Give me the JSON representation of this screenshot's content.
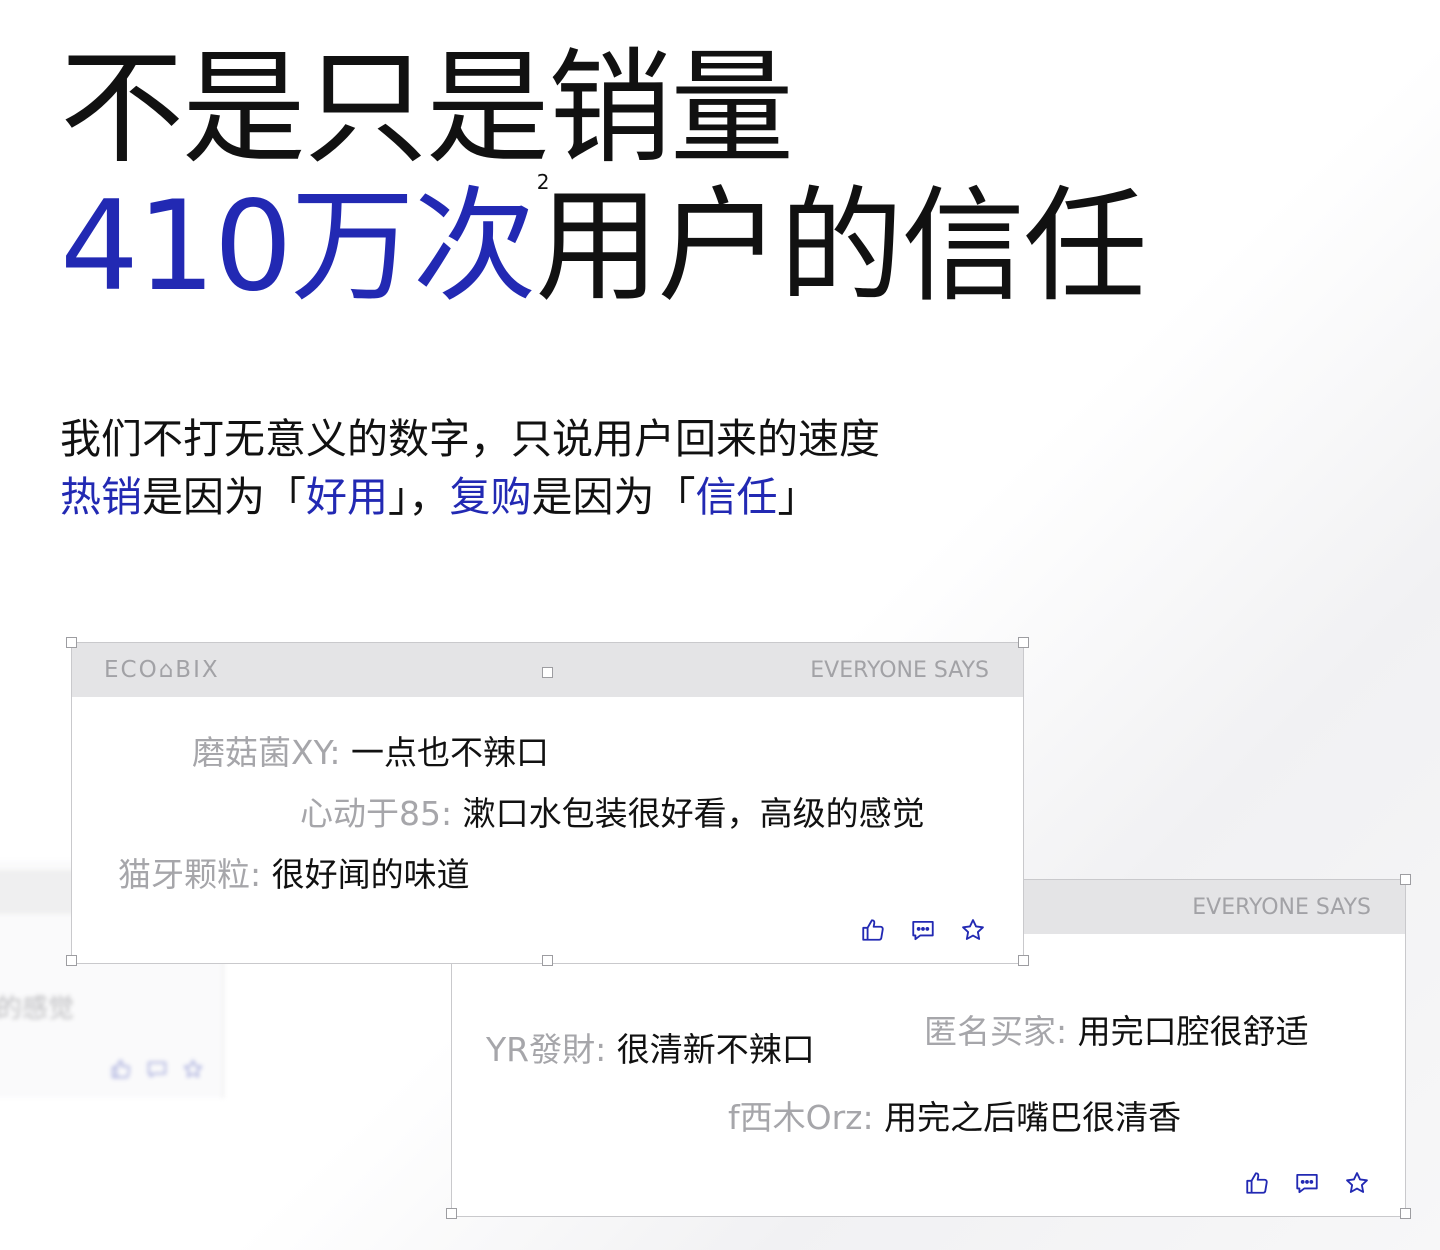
{
  "headline": {
    "line1": "不是只是销量",
    "line2_accent": "410万次",
    "line2_sup": "2",
    "line2_rest": "用户的信任"
  },
  "subtitle": {
    "line1": "我们不打无意义的数字，只说用户回来的速度",
    "line2": {
      "p1_accent": "热销",
      "p2": "是因为「",
      "p3_accent": "好用",
      "p4": "」，",
      "p5_accent": "复购",
      "p6": "是因为「",
      "p7_accent": "信任",
      "p8": "」"
    }
  },
  "ghost_card": {
    "text": "的感觉"
  },
  "card1": {
    "brand": "ECO⌂BIX",
    "header_right": "EVERYONE SAYS",
    "comments": [
      {
        "user": "磨菇菌XY: ",
        "text": "一点也不辣口"
      },
      {
        "user": "心动于85: ",
        "text": "漱口水包装很好看，高级的感觉"
      },
      {
        "user": "猫牙颗粒: ",
        "text": "很好闻的味道"
      }
    ],
    "icons": [
      "thumbs-up-icon",
      "comment-icon",
      "star-icon"
    ]
  },
  "card2": {
    "header_right": "EVERYONE SAYS",
    "comments": [
      {
        "user": "YR發財: ",
        "text": "很清新不辣口"
      },
      {
        "user": "匿名买家: ",
        "text": "用完口腔很舒适"
      },
      {
        "user": "f西木Orz: ",
        "text": "用完之后嘴巴很清香"
      }
    ],
    "icons": [
      "thumbs-up-icon",
      "comment-icon",
      "star-icon"
    ]
  },
  "colors": {
    "accent": "#2229b3",
    "muted": "#a6a6aa",
    "header_bg": "#e4e4e6"
  }
}
